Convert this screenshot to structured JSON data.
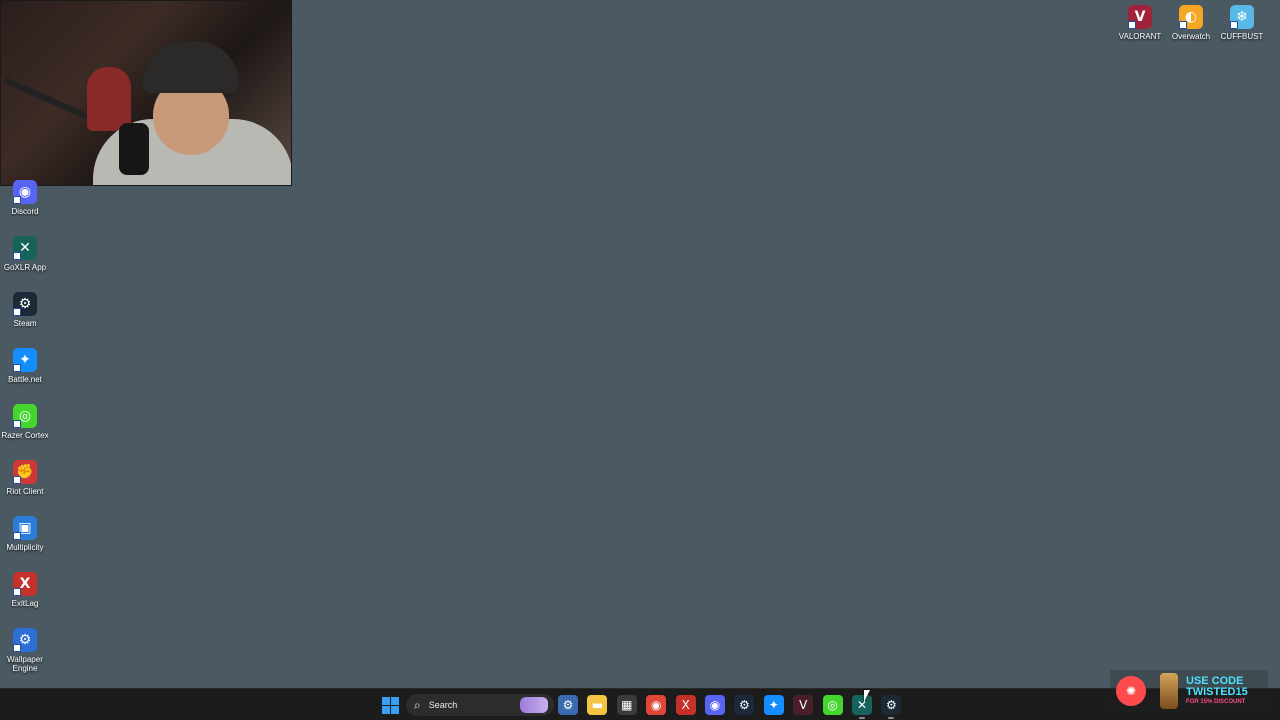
{
  "desktop": {
    "left_icons": [
      {
        "label": "Discord",
        "color": "#5865f2",
        "glyph": "◉"
      },
      {
        "label": "GoXLR App",
        "color": "#17635b",
        "glyph": "✕"
      },
      {
        "label": "Steam",
        "color": "#1b2838",
        "glyph": "⚙"
      },
      {
        "label": "Battle.net",
        "color": "#148eff",
        "glyph": "✦"
      },
      {
        "label": "Razer Cortex",
        "color": "#44d62c",
        "glyph": "◎"
      },
      {
        "label": "Riot Client",
        "color": "#d13639",
        "glyph": "✊"
      },
      {
        "label": "Multiplicity",
        "color": "#2b7bd8",
        "glyph": "▣"
      },
      {
        "label": "ExitLag",
        "color": "#c6302b",
        "glyph": "X"
      },
      {
        "label": "Wallpaper Engine",
        "color": "#2d6fd6",
        "glyph": "⚙"
      }
    ],
    "top_right_icons": [
      {
        "label": "VALORANT",
        "color": "#a1223b",
        "glyph": "V"
      },
      {
        "label": "Overwatch",
        "color": "#f5a623",
        "glyph": "◐"
      },
      {
        "label": "CUFFBUST",
        "color": "#58b8e8",
        "glyph": "❄"
      }
    ]
  },
  "taskbar": {
    "search_placeholder": "Search",
    "apps": [
      {
        "name": "settings",
        "glyph": "⚙",
        "color": "#3a6bb0",
        "running": false
      },
      {
        "name": "file-explorer",
        "glyph": "▬",
        "color": "#f4c542",
        "running": false
      },
      {
        "name": "microsoft-store",
        "glyph": "▦",
        "color": "#3b3b3b",
        "running": false
      },
      {
        "name": "chrome",
        "glyph": "◉",
        "color": "#e0473b",
        "running": false
      },
      {
        "name": "exitlag",
        "glyph": "X",
        "color": "#c6302b",
        "running": false
      },
      {
        "name": "discord",
        "glyph": "◉",
        "color": "#5865f2",
        "running": false
      },
      {
        "name": "steam",
        "glyph": "⚙",
        "color": "#1b2838",
        "running": false
      },
      {
        "name": "battle-net",
        "glyph": "✦",
        "color": "#148eff",
        "running": false
      },
      {
        "name": "valorant",
        "glyph": "V",
        "color": "#4a1f2a",
        "running": false
      },
      {
        "name": "razer-cortex",
        "glyph": "◎",
        "color": "#44d62c",
        "running": false
      },
      {
        "name": "goxlr",
        "glyph": "✕",
        "color": "#17635b",
        "running": true
      },
      {
        "name": "steam-running",
        "glyph": "⚙",
        "color": "#1b2838",
        "running": true
      }
    ]
  },
  "promo": {
    "line1": "USE CODE",
    "line2": "TWISTED15",
    "line3": "FOR 15% DISCOUNT"
  }
}
